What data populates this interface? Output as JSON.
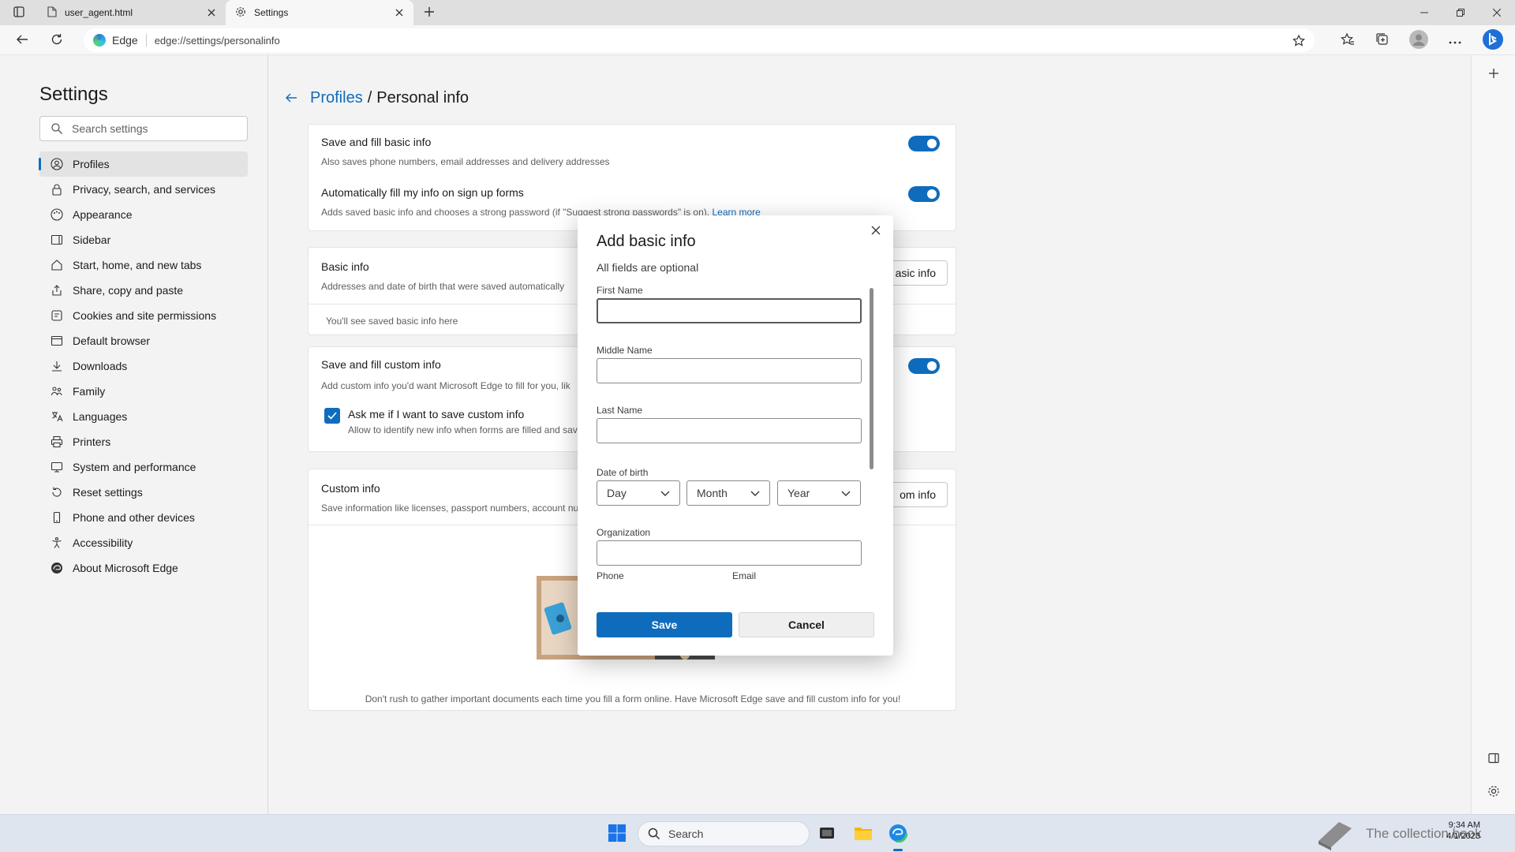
{
  "browser": {
    "tabs": [
      {
        "title": "user_agent.html",
        "active": false
      },
      {
        "title": "Settings",
        "active": true
      }
    ],
    "site_chip": "Edge",
    "url": "edge://settings/personalinfo"
  },
  "sidebar": {
    "title": "Settings",
    "search_placeholder": "Search settings",
    "items": [
      {
        "label": "Profiles",
        "icon": "profile-icon",
        "selected": true
      },
      {
        "label": "Privacy, search, and services",
        "icon": "lock-icon"
      },
      {
        "label": "Appearance",
        "icon": "appearance-icon"
      },
      {
        "label": "Sidebar",
        "icon": "sidebar-icon"
      },
      {
        "label": "Start, home, and new tabs",
        "icon": "home-icon"
      },
      {
        "label": "Share, copy and paste",
        "icon": "share-icon"
      },
      {
        "label": "Cookies and site permissions",
        "icon": "cookie-icon"
      },
      {
        "label": "Default browser",
        "icon": "browser-icon"
      },
      {
        "label": "Downloads",
        "icon": "download-icon"
      },
      {
        "label": "Family",
        "icon": "family-icon"
      },
      {
        "label": "Languages",
        "icon": "language-icon"
      },
      {
        "label": "Printers",
        "icon": "printer-icon"
      },
      {
        "label": "System and performance",
        "icon": "system-icon"
      },
      {
        "label": "Reset settings",
        "icon": "reset-icon"
      },
      {
        "label": "Phone and other devices",
        "icon": "phone-icon"
      },
      {
        "label": "Accessibility",
        "icon": "accessibility-icon"
      },
      {
        "label": "About Microsoft Edge",
        "icon": "edge-icon"
      }
    ]
  },
  "breadcrumb": {
    "parent": "Profiles",
    "separator": "/",
    "current": "Personal info"
  },
  "cards": {
    "save_fill": {
      "title": "Save and fill basic info",
      "description": "Also saves phone numbers, email addresses and delivery addresses",
      "toggle_on": true
    },
    "auto_fill": {
      "title": "Automatically fill my info on sign up forms",
      "description": "Adds saved basic info and chooses a strong password (if \"Suggest strong passwords\" is on).",
      "link": "Learn more",
      "toggle_on": true
    },
    "basic_info": {
      "title": "Basic info",
      "description": "Addresses and date of birth that were saved automatically",
      "button": "Add basic info",
      "button_visible": "asic info",
      "empty": "You'll see saved basic info here"
    },
    "custom_fill": {
      "title": "Save and fill custom info",
      "description": "Add custom info you'd want Microsoft Edge to fill for you, lik",
      "toggle_on": true,
      "checkbox_label": "Ask me if I want to save custom info",
      "checkbox_desc": "Allow to identify new info when forms are filled and sav",
      "checkbox_checked": true
    },
    "custom_info": {
      "title": "Custom info",
      "description": "Save information like licenses, passport numbers, account nu",
      "button_visible": "om info",
      "footer": "Don't rush to gather important documents each time you fill a form online. Have Microsoft Edge save and fill custom info for you!"
    }
  },
  "dialog": {
    "title": "Add basic info",
    "subtitle": "All fields are optional",
    "labels": {
      "first_name": "First Name",
      "middle_name": "Middle Name",
      "last_name": "Last Name",
      "dob": "Date of birth",
      "organization": "Organization",
      "phone": "Phone",
      "email": "Email"
    },
    "values": {
      "first_name": "",
      "middle_name": "",
      "last_name": "",
      "organization": ""
    },
    "dob_selects": {
      "day": "Day",
      "month": "Month",
      "year": "Year"
    },
    "save": "Save",
    "cancel": "Cancel"
  },
  "taskbar": {
    "search_label": "Search",
    "time": "9:34 AM",
    "date": "4/1/2023",
    "watermark": "The collection book"
  },
  "colors": {
    "accent": "#0f6cbd",
    "page_bg": "#f3f3f3",
    "card_bg": "#ffffff"
  }
}
